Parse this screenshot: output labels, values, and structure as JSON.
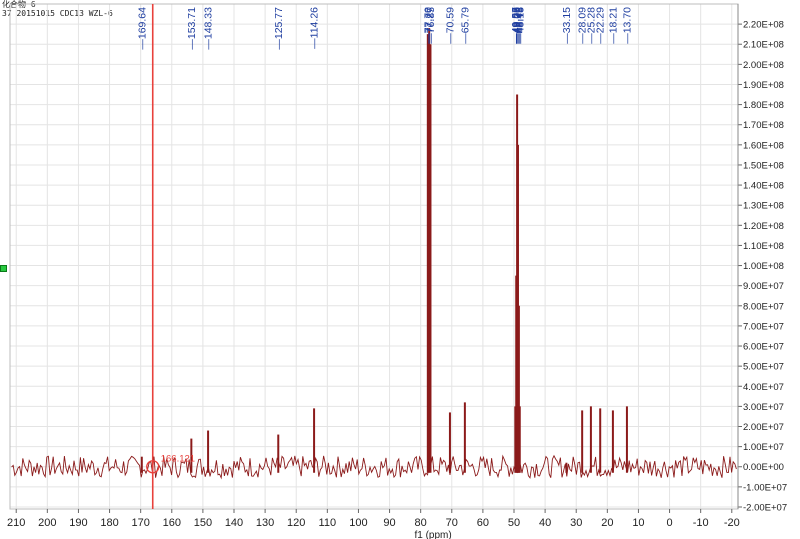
{
  "header": {
    "line1": "化合物 6",
    "line2": "37 20151015 CDC13 WZL-6"
  },
  "colors": {
    "spectrum": "#8b1a1a",
    "cursor": "#e8413c",
    "peak_label": "#1f3ea0",
    "grid": "#e4e4e4",
    "axis_text": "#222222"
  },
  "cursor": {
    "ppm": 166.121,
    "label": "166.121"
  },
  "chart_data": {
    "type": "line",
    "title": "",
    "xlabel": "f1 (ppm)",
    "ylabel": "",
    "xlim": [
      212,
      -22
    ],
    "x_reversed": true,
    "ylim": [
      -21000000.0,
      230000000.0
    ],
    "grid": true,
    "x_ticks": [
      210,
      200,
      190,
      180,
      170,
      160,
      150,
      140,
      130,
      120,
      110,
      100,
      90,
      80,
      70,
      60,
      50,
      40,
      30,
      20,
      10,
      0,
      -10,
      -20
    ],
    "x_tick_labels": [
      "210",
      "200",
      "190",
      "180",
      "170",
      "160",
      "150",
      "140",
      "130",
      "120",
      "110",
      "100",
      "90",
      "80",
      "70",
      "60",
      "50",
      "40",
      "30",
      "20",
      "10",
      "0",
      "-10",
      "-20"
    ],
    "y_ticks": [
      220000000.0,
      210000000.0,
      200000000.0,
      190000000.0,
      180000000.0,
      170000000.0,
      160000000.0,
      150000000.0,
      140000000.0,
      130000000.0,
      120000000.0,
      110000000.0,
      100000000.0,
      90000000.0,
      80000000.0,
      70000000.0,
      60000000.0,
      50000000.0,
      40000000.0,
      30000000.0,
      20000000.0,
      10000000.0,
      0,
      -10000000.0,
      -20000000.0
    ],
    "y_tick_labels": [
      "2.20E+08",
      "2.10E+08",
      "2.00E+08",
      "1.90E+08",
      "1.80E+08",
      "1.70E+08",
      "1.60E+08",
      "1.50E+08",
      "1.40E+08",
      "1.30E+08",
      "1.20E+08",
      "1.10E+08",
      "1.00E+08",
      "9.00E+07",
      "8.00E+07",
      "7.00E+07",
      "6.00E+07",
      "5.00E+07",
      "4.00E+07",
      "3.00E+07",
      "2.00E+07",
      "1.00E+07",
      "0.00E+00",
      "-1.00E+07",
      "-2.00E+07"
    ],
    "noise_amplitude": 5500000.0,
    "peaks": [
      {
        "ppm": 169.64,
        "label": "169.64",
        "intensity": 5000000.0
      },
      {
        "ppm": 153.71,
        "label": "153.71",
        "intensity": 14000000.0
      },
      {
        "ppm": 148.33,
        "label": "148.33",
        "intensity": 18000000.0
      },
      {
        "ppm": 125.77,
        "label": "125.77",
        "intensity": 16000000.0
      },
      {
        "ppm": 114.26,
        "label": "114.26",
        "intensity": 29000000.0
      },
      {
        "ppm": 77.7,
        "label": "77.70",
        "intensity": 215000000.0
      },
      {
        "ppm": 77.27,
        "label": "77.27",
        "intensity": 218000000.0
      },
      {
        "ppm": 76.85,
        "label": "76.85",
        "intensity": 210000000.0
      },
      {
        "ppm": 70.59,
        "label": "70.59",
        "intensity": 27000000.0
      },
      {
        "ppm": 65.79,
        "label": "65.79",
        "intensity": 32000000.0
      },
      {
        "ppm": 49.57,
        "label": "49.57",
        "intensity": 30000000.0
      },
      {
        "ppm": 49.28,
        "label": "49.28",
        "intensity": 95000000.0
      },
      {
        "ppm": 49.0,
        "label": "49.00",
        "intensity": 185000000.0
      },
      {
        "ppm": 48.72,
        "label": "48.72",
        "intensity": 160000000.0
      },
      {
        "ppm": 48.43,
        "label": "48.43",
        "intensity": 80000000.0
      },
      {
        "ppm": 48.15,
        "label": "48.15",
        "intensity": 30000000.0
      },
      {
        "ppm": 33.15,
        "label": "33.15",
        "intensity": 2000000.0
      },
      {
        "ppm": 28.09,
        "label": "28.09",
        "intensity": 28000000.0
      },
      {
        "ppm": 25.28,
        "label": "25.28",
        "intensity": 30000000.0
      },
      {
        "ppm": 22.29,
        "label": "22.29",
        "intensity": 29000000.0
      },
      {
        "ppm": 18.21,
        "label": "18.21",
        "intensity": 28000000.0
      },
      {
        "ppm": 13.7,
        "label": "13.70",
        "intensity": 30000000.0
      }
    ]
  }
}
